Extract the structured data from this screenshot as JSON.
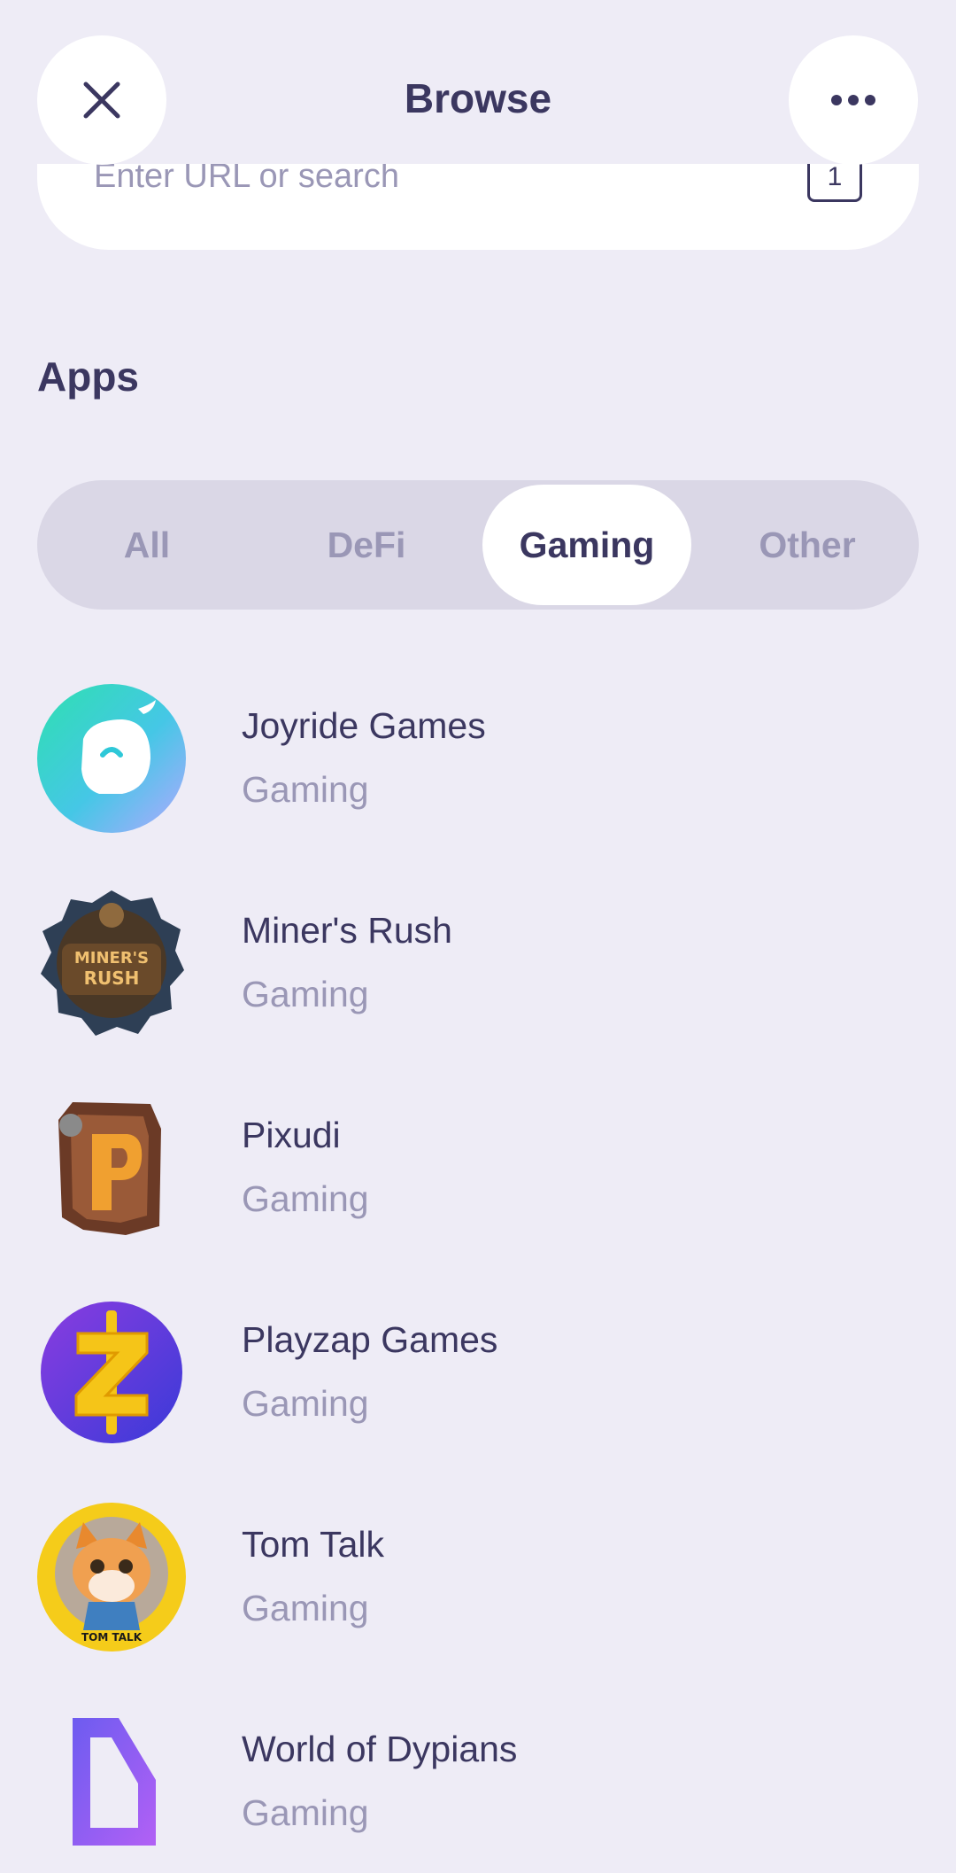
{
  "header": {
    "title": "Browse",
    "close_icon": "close-icon",
    "more_icon": "more-horizontal-icon"
  },
  "search": {
    "placeholder": "Enter URL or search",
    "tab_count": "1"
  },
  "apps_section": {
    "title": "Apps",
    "filters": [
      "All",
      "DeFi",
      "Gaming",
      "Other"
    ],
    "selected_filter": "Gaming",
    "items": [
      {
        "name": "Joyride Games",
        "category": "Gaming",
        "icon": "joyride-logo"
      },
      {
        "name": "Miner's Rush",
        "category": "Gaming",
        "icon": "miners-rush-logo",
        "logo_text": "MINER'S RUSH"
      },
      {
        "name": "Pixudi",
        "category": "Gaming",
        "icon": "pixudi-logo",
        "logo_text": "P"
      },
      {
        "name": "Playzap Games",
        "category": "Gaming",
        "icon": "playzap-logo",
        "logo_text": "Z"
      },
      {
        "name": "Tom Talk",
        "category": "Gaming",
        "icon": "tom-talk-logo",
        "logo_text": "TOM TALK"
      },
      {
        "name": "World of Dypians",
        "category": "Gaming",
        "icon": "world-of-dypians-logo"
      }
    ]
  },
  "colors": {
    "background": "#eeecf6",
    "primary_text": "#3b3760",
    "secondary_text": "#9a97b6",
    "segment_track": "#dad7e6",
    "surface": "#ffffff"
  }
}
